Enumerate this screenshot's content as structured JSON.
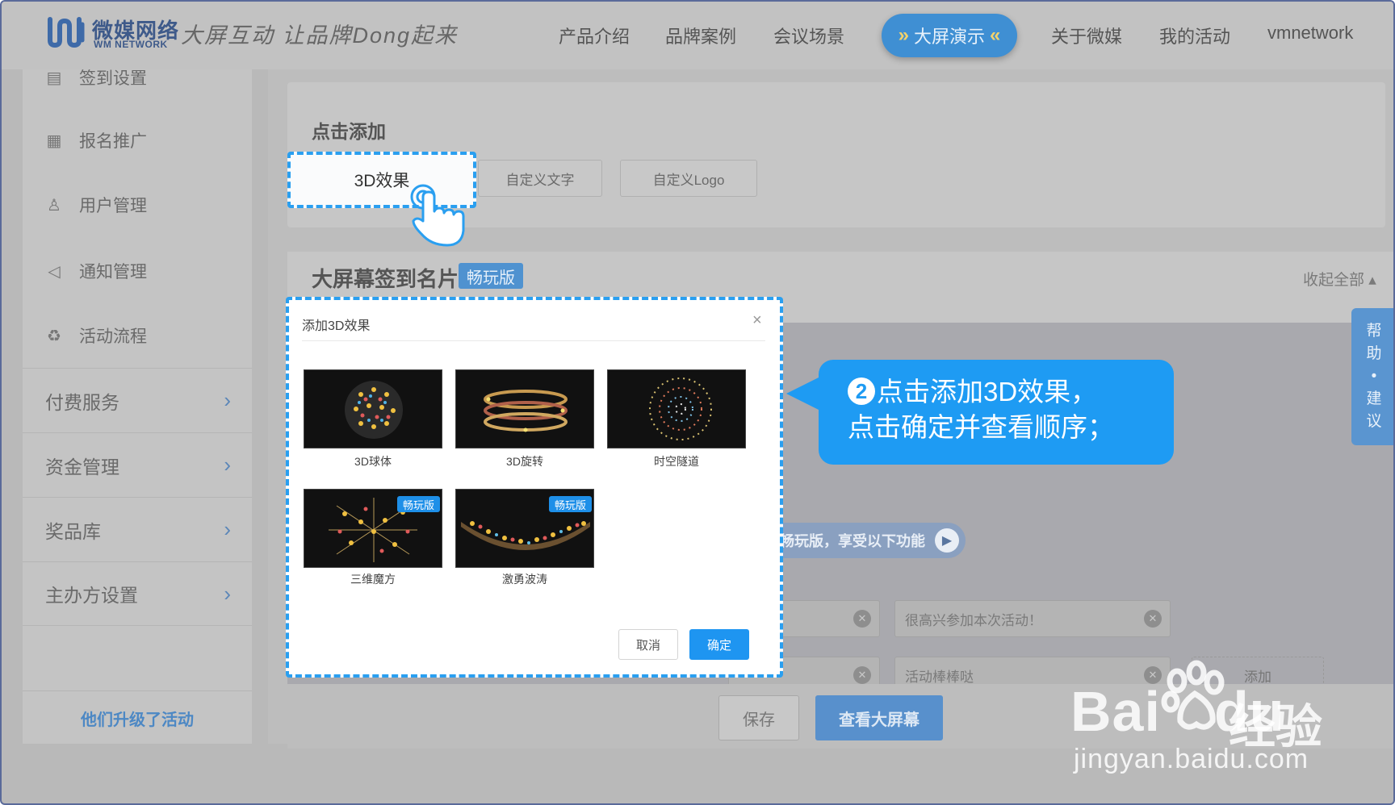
{
  "header": {
    "logo_cn": "微媒网络",
    "logo_en": "WM NETWORK",
    "slogan": "大屏互动 让品牌Dong起来",
    "nav": [
      "产品介绍",
      "品牌案例",
      "会议场景",
      "大屏演示",
      "关于微媒",
      "我的活动",
      "vmnetwork"
    ],
    "active_nav": "大屏演示"
  },
  "sidebar": {
    "items": [
      {
        "label": "签到设置",
        "icon": "checkin-icon"
      },
      {
        "label": "报名推广",
        "icon": "clipboard-icon"
      },
      {
        "label": "用户管理",
        "icon": "user-icon"
      },
      {
        "label": "通知管理",
        "icon": "megaphone-icon"
      },
      {
        "label": "活动流程",
        "icon": "flow-icon"
      }
    ],
    "groups": [
      "付费服务",
      "资金管理",
      "奖品库",
      "主办方设置"
    ],
    "bottom_link": "他们升级了活动"
  },
  "main": {
    "click_add_title": "点击添加",
    "add_buttons": [
      "3D效果",
      "自定义文字",
      "自定义Logo"
    ],
    "section_title": "大屏幕签到名片",
    "section_badge": "畅玩版",
    "collapse_all": "收起全部",
    "vip_pill": "畅玩版，享受以下功能",
    "fields": [
      "很高兴参加本次活动！",
      "活动棒棒哒"
    ],
    "add_label": "添加",
    "save_label": "保存",
    "view_label": "查看大屏幕",
    "help_tab": [
      "帮",
      "助",
      "•",
      "建",
      "议"
    ]
  },
  "modal": {
    "title": "添加3D效果",
    "close": "×",
    "effects": [
      {
        "label": "3D球体",
        "badge": ""
      },
      {
        "label": "3D旋转",
        "badge": ""
      },
      {
        "label": "时空隧道",
        "badge": ""
      },
      {
        "label": "三维魔方",
        "badge": "畅玩版"
      },
      {
        "label": "激勇波涛",
        "badge": "畅玩版"
      }
    ],
    "cancel_label": "取消",
    "ok_label": "确定"
  },
  "callout": {
    "number": "2",
    "line1": "点击添加3D效果，",
    "line2": "点击确定并查看顺序；"
  },
  "watermark": {
    "baidu": "Bai",
    "du": "du",
    "jingyan": "经验",
    "url": "jingyan.baidu.com"
  },
  "colors": {
    "accent": "#1e95f1",
    "callout_bg": "#1e9bf3",
    "nav_active_bg": "#3f8fd3",
    "overlay_gray": "#bdbdbd"
  }
}
